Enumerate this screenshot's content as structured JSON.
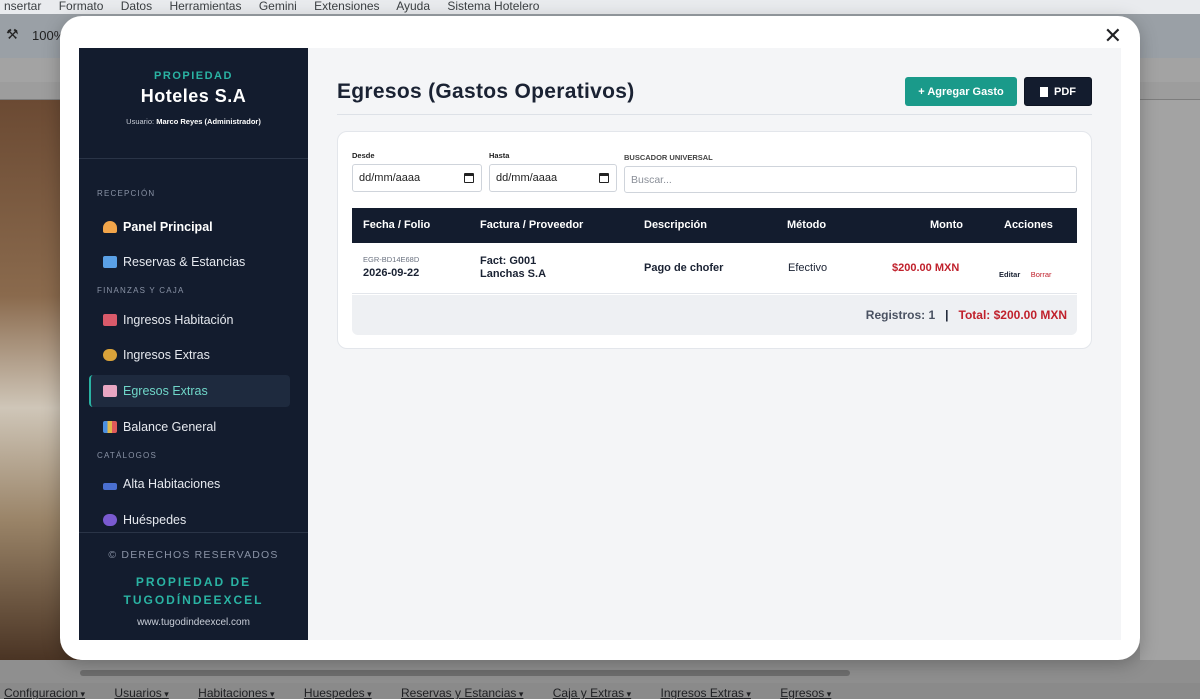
{
  "background": {
    "menubar": [
      "nsertar",
      "Formato",
      "Datos",
      "Herramientas",
      "Gemini",
      "Extensiones",
      "Ayuda",
      "Sistema Hotelero"
    ],
    "zoom": "100%",
    "sheet_tabs": [
      "Configuracion",
      "Usuarios",
      "Habitaciones",
      "Huespedes",
      "Reservas y Estancias",
      "Caja y Extras",
      "Ingresos Extras",
      "Egresos"
    ]
  },
  "sidebar": {
    "property_label": "PROPIEDAD",
    "brand": "Hoteles S.A",
    "user_prefix": "Usuario:",
    "user_name": "Marco Reyes (Administrador)",
    "sections": {
      "reception": "RECEPCIÓN",
      "finance": "FINANZAS Y CAJA",
      "catalogs": "CATÁLOGOS"
    },
    "items": {
      "panel": "Panel Principal",
      "reservas": "Reservas & Estancias",
      "ingresos_hab": "Ingresos Habitación",
      "ingresos_extras": "Ingresos Extras",
      "egresos_extras": "Egresos Extras",
      "balance": "Balance General",
      "alta_hab": "Alta Habitaciones",
      "huespedes": "Huéspedes"
    },
    "footer": {
      "copyright": "© DERECHOS RESERVADOS",
      "owner": "PROPIEDAD DE TUGODÍNDEEXCEL",
      "url": "www.tugodindeexcel.com"
    }
  },
  "main": {
    "title": "Egresos (Gastos Operativos)",
    "add_button": "+ Agregar Gasto",
    "pdf_button": "PDF",
    "filters": {
      "from_label": "Desde",
      "from_value": "dd/mm/aaaa",
      "to_label": "Hasta",
      "to_value": "dd/mm/aaaa",
      "search_label": "BUSCADOR UNIVERSAL",
      "search_placeholder": "Buscar..."
    },
    "table": {
      "headers": {
        "fecha": "Fecha / Folio",
        "factura": "Factura / Proveedor",
        "descripcion": "Descripción",
        "metodo": "Método",
        "monto": "Monto",
        "acciones": "Acciones"
      },
      "rows": [
        {
          "folio": "EGR-BD14E68D",
          "fecha": "2026-09-22",
          "factura": "Fact: G001",
          "proveedor": "Lanchas S.A",
          "descripcion": "Pago de chofer",
          "metodo": "Efectivo",
          "monto": "$200.00 MXN",
          "edit": "Editar",
          "delete": "Borrar"
        }
      ],
      "footer": {
        "registros": "Registros: 1",
        "separator": "|",
        "total": "Total: $200.00 MXN"
      }
    }
  },
  "colors": {
    "sidebar_bg": "#131c2e",
    "accent_teal": "#1a9a8a",
    "danger_red": "#c0212c"
  }
}
